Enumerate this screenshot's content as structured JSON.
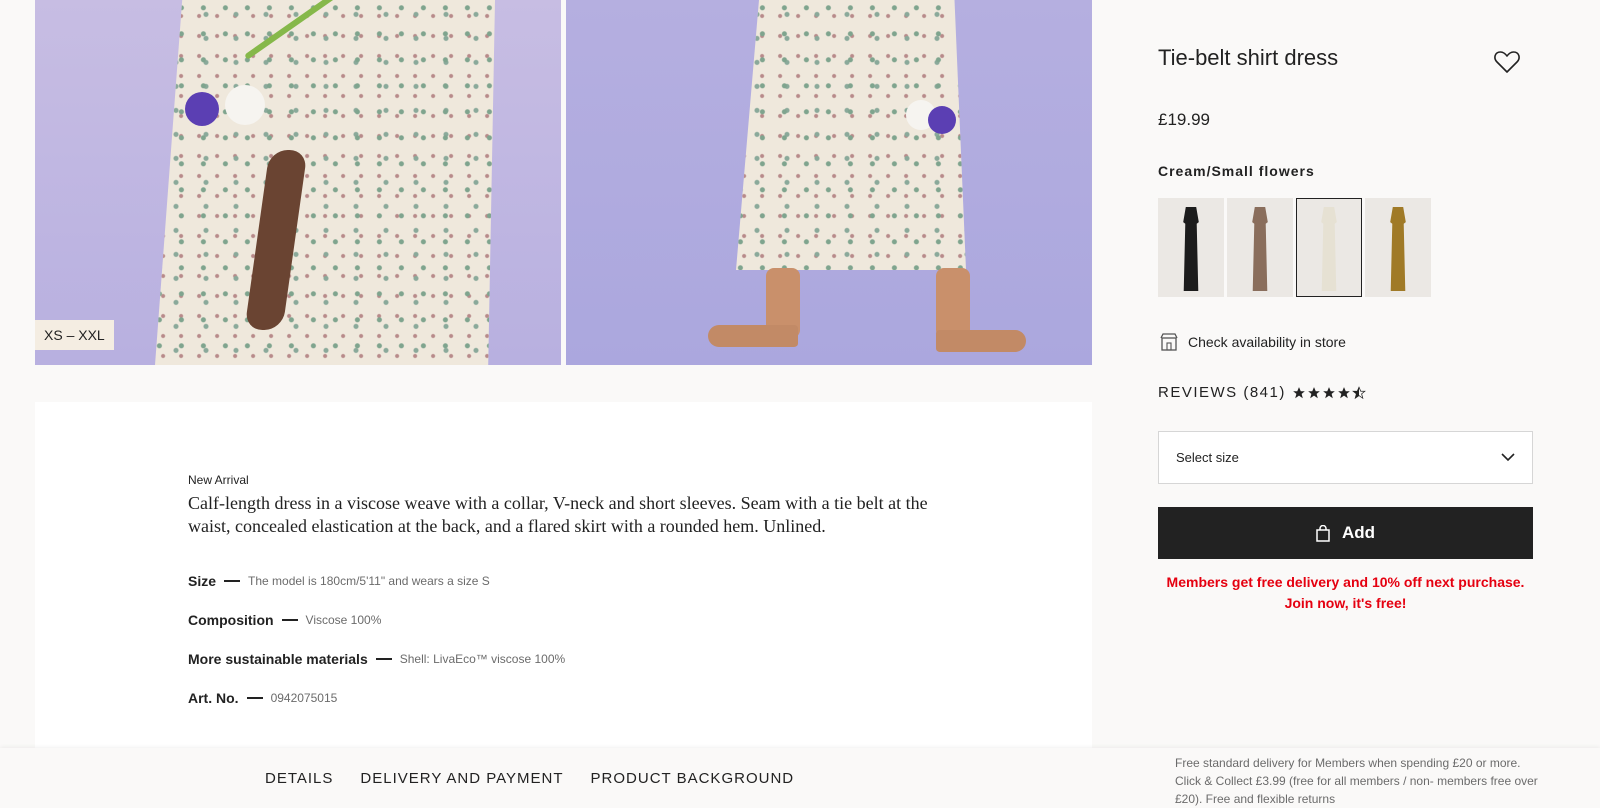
{
  "gallery": {
    "size_range": "XS – XXL"
  },
  "product": {
    "title": "Tie-belt shirt dress",
    "price": "£19.99",
    "color_name": "Cream/Small flowers",
    "swatches": [
      {
        "color": "#1c1c1c"
      },
      {
        "color": "#8a6e5c"
      },
      {
        "color": "#e6e1d3"
      },
      {
        "color": "#a07a27"
      }
    ],
    "active_swatch": 2,
    "check_store_label": "Check availability in store",
    "reviews_label": "REVIEWS (841)",
    "rating": 4.5,
    "select_size_label": "Select size",
    "add_label": "Add",
    "promo_line1": "Members get free delivery and 10% off next purchase.",
    "promo_line2": "Join now, it's free!"
  },
  "description": {
    "tag": "New Arrival",
    "text": "Calf-length dress in a viscose weave with a collar, V-neck and short sleeves. Seam with a tie belt at the waist, concealed elastication at the back, and a flared skirt with a rounded hem. Unlined.",
    "specs": [
      {
        "label": "Size",
        "value": "The model is 180cm/5'11\" and wears a size S"
      },
      {
        "label": "Composition",
        "value": "Viscose 100%"
      },
      {
        "label": "More sustainable materials",
        "value": "Shell: LivaEco™ viscose 100%"
      },
      {
        "label": "Art. No.",
        "value": "0942075015"
      }
    ]
  },
  "bottom_bar": {
    "tabs": [
      "DETAILS",
      "DELIVERY AND PAYMENT",
      "PRODUCT BACKGROUND"
    ],
    "delivery_note": "Free standard delivery for Members when spending £20 or more. Click & Collect £3.99 (free for all members / non- members free over £20). Free and flexible returns"
  },
  "colors": {
    "accent_red": "#e50010",
    "button_dark": "#222222"
  }
}
